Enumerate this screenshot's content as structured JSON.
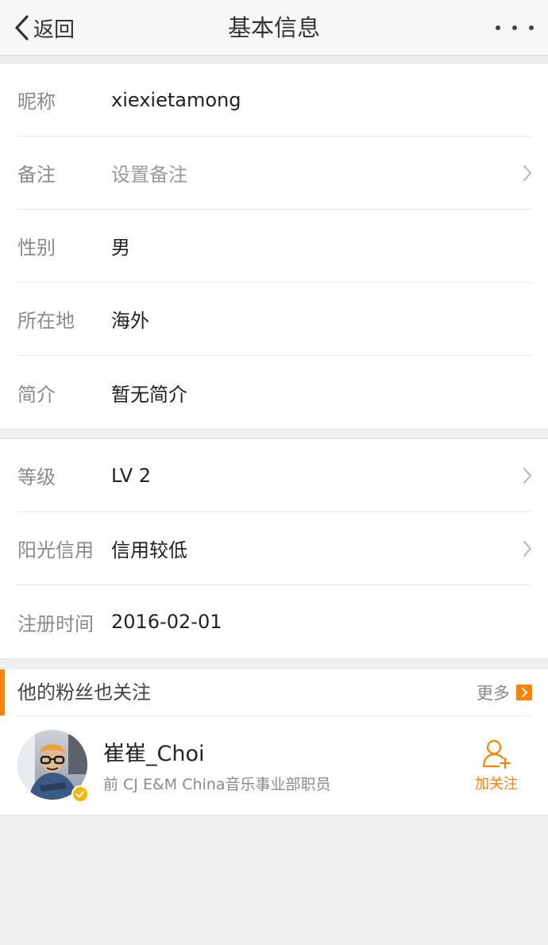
{
  "header": {
    "back_label": "返回",
    "title": "基本信息",
    "more_icon": "more-dots-icon"
  },
  "basic_info": [
    {
      "label": "昵称",
      "value": "xiexietamong",
      "placeholder": false,
      "chevron": false
    },
    {
      "label": "备注",
      "value": "设置备注",
      "placeholder": true,
      "chevron": true
    },
    {
      "label": "性别",
      "value": "男",
      "placeholder": false,
      "chevron": false
    },
    {
      "label": "所在地",
      "value": "海外",
      "placeholder": false,
      "chevron": false
    },
    {
      "label": "简介",
      "value": "暂无简介",
      "placeholder": false,
      "chevron": false
    }
  ],
  "account_info": [
    {
      "label": "等级",
      "value": "LV 2",
      "placeholder": false,
      "chevron": true
    },
    {
      "label": "阳光信用",
      "value": "信用较低",
      "placeholder": false,
      "chevron": true
    },
    {
      "label": "注册时间",
      "value": "2016-02-01",
      "placeholder": false,
      "chevron": false
    }
  ],
  "fans_also_follow": {
    "title": "他的粉丝也关注",
    "more_label": "更多",
    "user": {
      "name": "崔崔_Choi",
      "description": "前 CJ E&M China音乐事业部职员",
      "follow_label": "加关注",
      "verified": true
    }
  },
  "colors": {
    "accent": "#ff8200",
    "verified_badge": "#f5b800",
    "background": "#efefef"
  }
}
